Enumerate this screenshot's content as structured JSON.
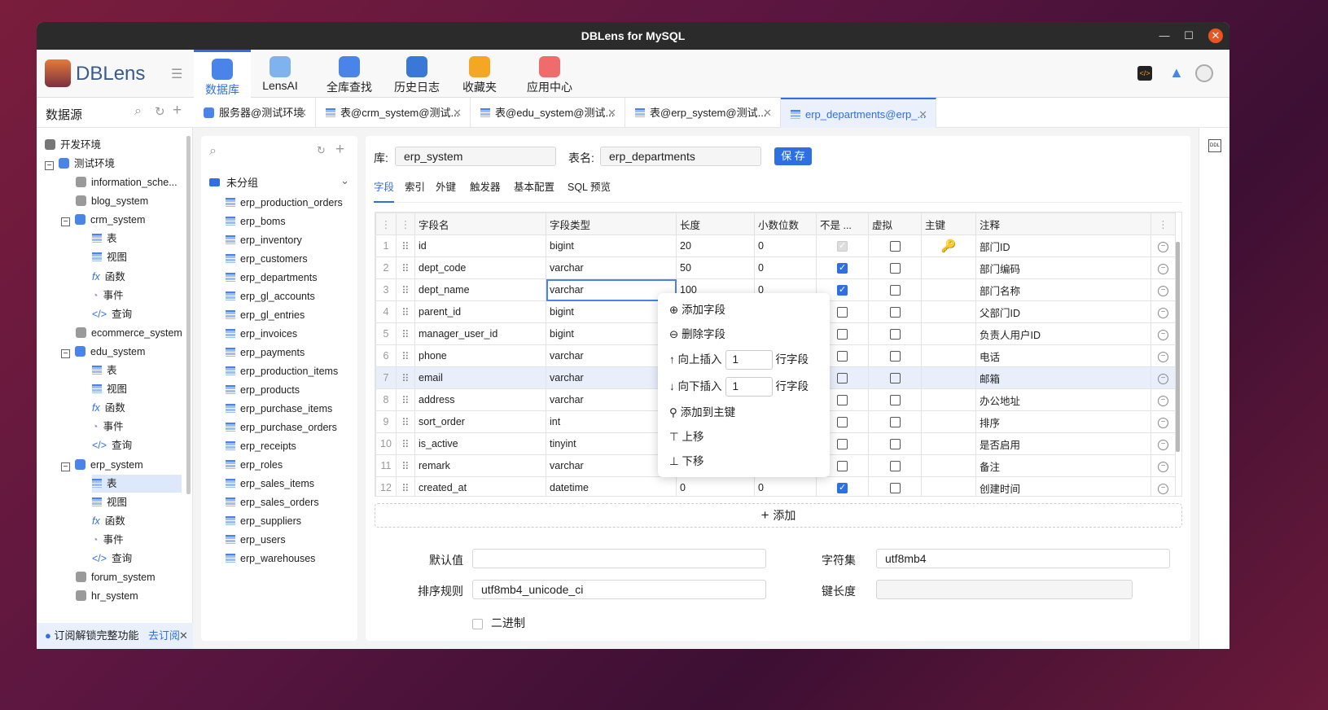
{
  "window": {
    "title": "DBLens for MySQL"
  },
  "logo": "DBLens",
  "nav": [
    {
      "label": "数据库",
      "color": "#4a84e8"
    },
    {
      "label": "LensAI",
      "color": "#7fb3f0"
    },
    {
      "label": "全库查找",
      "color": "#4a84e8"
    },
    {
      "label": "历史日志",
      "color": "#3a78d8"
    },
    {
      "label": "收藏夹",
      "color": "#f5a623"
    },
    {
      "label": "应用中心",
      "color": "#f06b6b"
    }
  ],
  "sidebar": {
    "title": "数据源",
    "groups": [
      "开发环境",
      "测试环境"
    ],
    "tree": [
      {
        "label": "information_sche...",
        "type": "db",
        "indent": 1
      },
      {
        "label": "blog_system",
        "type": "db",
        "indent": 1
      },
      {
        "label": "crm_system",
        "type": "db",
        "indent": 1,
        "open": true
      },
      {
        "label": "表",
        "type": "table",
        "indent": 2
      },
      {
        "label": "视图",
        "type": "view",
        "indent": 2
      },
      {
        "label": "函数",
        "type": "fx",
        "indent": 2
      },
      {
        "label": "事件",
        "type": "event",
        "indent": 2
      },
      {
        "label": "查询",
        "type": "query",
        "indent": 2
      },
      {
        "label": "ecommerce_system",
        "type": "db",
        "indent": 1
      },
      {
        "label": "edu_system",
        "type": "db",
        "indent": 1,
        "open": true
      },
      {
        "label": "表",
        "type": "table",
        "indent": 2
      },
      {
        "label": "视图",
        "type": "view",
        "indent": 2
      },
      {
        "label": "函数",
        "type": "fx",
        "indent": 2
      },
      {
        "label": "事件",
        "type": "event",
        "indent": 2
      },
      {
        "label": "查询",
        "type": "query",
        "indent": 2
      },
      {
        "label": "erp_system",
        "type": "db",
        "indent": 1,
        "open": true
      },
      {
        "label": "表",
        "type": "table",
        "indent": 2,
        "selected": true
      },
      {
        "label": "视图",
        "type": "view",
        "indent": 2
      },
      {
        "label": "函数",
        "type": "fx",
        "indent": 2
      },
      {
        "label": "事件",
        "type": "event",
        "indent": 2
      },
      {
        "label": "查询",
        "type": "query",
        "indent": 2
      },
      {
        "label": "forum_system",
        "type": "db",
        "indent": 1
      },
      {
        "label": "hr_system",
        "type": "db",
        "indent": 1
      }
    ],
    "banner": {
      "text": "订阅解锁完整功能",
      "link": "去订阅"
    }
  },
  "tabs": [
    {
      "label": "服务器@测试环境"
    },
    {
      "label": "表@crm_system@测试..."
    },
    {
      "label": "表@edu_system@测试..."
    },
    {
      "label": "表@erp_system@测试..."
    },
    {
      "label": "erp_departments@erp_..."
    }
  ],
  "tablelist": {
    "group": "未分组",
    "items": [
      "erp_production_orders",
      "erp_boms",
      "erp_inventory",
      "erp_customers",
      "erp_departments",
      "erp_gl_accounts",
      "erp_gl_entries",
      "erp_invoices",
      "erp_payments",
      "erp_production_items",
      "erp_products",
      "erp_purchase_items",
      "erp_purchase_orders",
      "erp_receipts",
      "erp_roles",
      "erp_sales_items",
      "erp_sales_orders",
      "erp_suppliers",
      "erp_users",
      "erp_warehouses"
    ]
  },
  "editor": {
    "db_label": "库:",
    "db_value": "erp_system",
    "table_label": "表名:",
    "table_value": "erp_departments",
    "save": "保 存",
    "subtabs": [
      "字段",
      "索引",
      "外键",
      "触发器",
      "基本配置",
      "SQL 预览"
    ],
    "columns": [
      "字段名",
      "字段类型",
      "长度",
      "小数位数",
      "不是 ...",
      "虚拟",
      "主键",
      "注释"
    ],
    "rows": [
      {
        "n": "1",
        "name": "id",
        "type": "bigint",
        "len": "20",
        "dec": "0",
        "nn": "disabled",
        "virt": false,
        "pk": true,
        "comment": "部门ID"
      },
      {
        "n": "2",
        "name": "dept_code",
        "type": "varchar",
        "len": "50",
        "dec": "0",
        "nn": true,
        "virt": false,
        "pk": false,
        "comment": "部门编码"
      },
      {
        "n": "3",
        "name": "dept_name",
        "type": "varchar",
        "len": "100",
        "dec": "0",
        "nn": true,
        "virt": false,
        "pk": false,
        "comment": "部门名称"
      },
      {
        "n": "4",
        "name": "parent_id",
        "type": "bigint",
        "len": "",
        "dec": "",
        "nn": false,
        "virt": false,
        "pk": false,
        "comment": "父部门ID"
      },
      {
        "n": "5",
        "name": "manager_user_id",
        "type": "bigint",
        "len": "",
        "dec": "",
        "nn": false,
        "virt": false,
        "pk": false,
        "comment": "负责人用户ID"
      },
      {
        "n": "6",
        "name": "phone",
        "type": "varchar",
        "len": "",
        "dec": "",
        "nn": false,
        "virt": false,
        "pk": false,
        "comment": "电话"
      },
      {
        "n": "7",
        "name": "email",
        "type": "varchar",
        "len": "",
        "dec": "",
        "nn": false,
        "virt": false,
        "pk": false,
        "comment": "邮箱"
      },
      {
        "n": "8",
        "name": "address",
        "type": "varchar",
        "len": "",
        "dec": "",
        "nn": false,
        "virt": false,
        "pk": false,
        "comment": "办公地址"
      },
      {
        "n": "9",
        "name": "sort_order",
        "type": "int",
        "len": "",
        "dec": "",
        "nn": false,
        "virt": false,
        "pk": false,
        "comment": "排序"
      },
      {
        "n": "10",
        "name": "is_active",
        "type": "tinyint",
        "len": "",
        "dec": "",
        "nn": false,
        "virt": false,
        "pk": false,
        "comment": "是否启用"
      },
      {
        "n": "11",
        "name": "remark",
        "type": "varchar",
        "len": "",
        "dec": "",
        "nn": false,
        "virt": false,
        "pk": false,
        "comment": "备注"
      },
      {
        "n": "12",
        "name": "created_at",
        "type": "datetime",
        "len": "0",
        "dec": "0",
        "nn": true,
        "virt": false,
        "pk": false,
        "comment": "创建时间"
      }
    ],
    "add": "添加",
    "default_label": "默认值",
    "default_value": "",
    "charset_label": "字符集",
    "charset_value": "utf8mb4",
    "collation_label": "排序规则",
    "collation_value": "utf8mb4_unicode_ci",
    "keylen_label": "键长度",
    "keylen_value": "",
    "binary_label": "二进制"
  },
  "context_menu": {
    "add": "添加字段",
    "delete": "删除字段",
    "insert_above": "向上插入",
    "insert_below": "向下插入",
    "count_above": "1",
    "count_below": "1",
    "row_suffix": "行字段",
    "add_pk": "添加到主键",
    "move_up": "上移",
    "move_down": "下移"
  },
  "right": {
    "ddl": "DDL"
  }
}
